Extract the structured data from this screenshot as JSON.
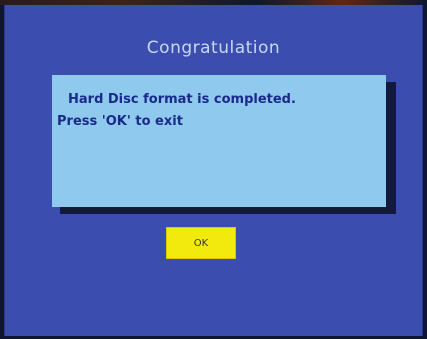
{
  "dialog": {
    "title": "Congratulation",
    "message_line_1": "Hard Disc format is completed.",
    "message_line_2": "Press 'OK' to exit",
    "ok_label": "OK"
  },
  "colors": {
    "panel_background": "#3c4db0",
    "message_background": "#8fc9ee",
    "message_text": "#1a2a8a",
    "button_background": "#f2ea0c",
    "title_text": "#c8d8f4"
  }
}
